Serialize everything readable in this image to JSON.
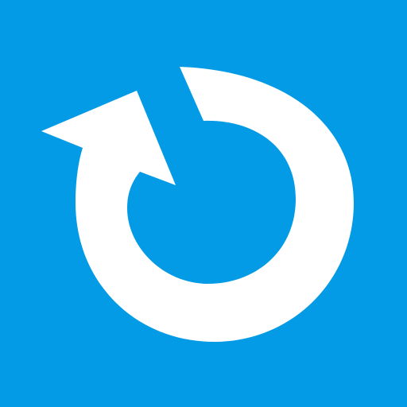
{
  "icon": {
    "name": "refresh-icon",
    "background_color": "#039be5",
    "foreground_color": "#ffffff"
  }
}
